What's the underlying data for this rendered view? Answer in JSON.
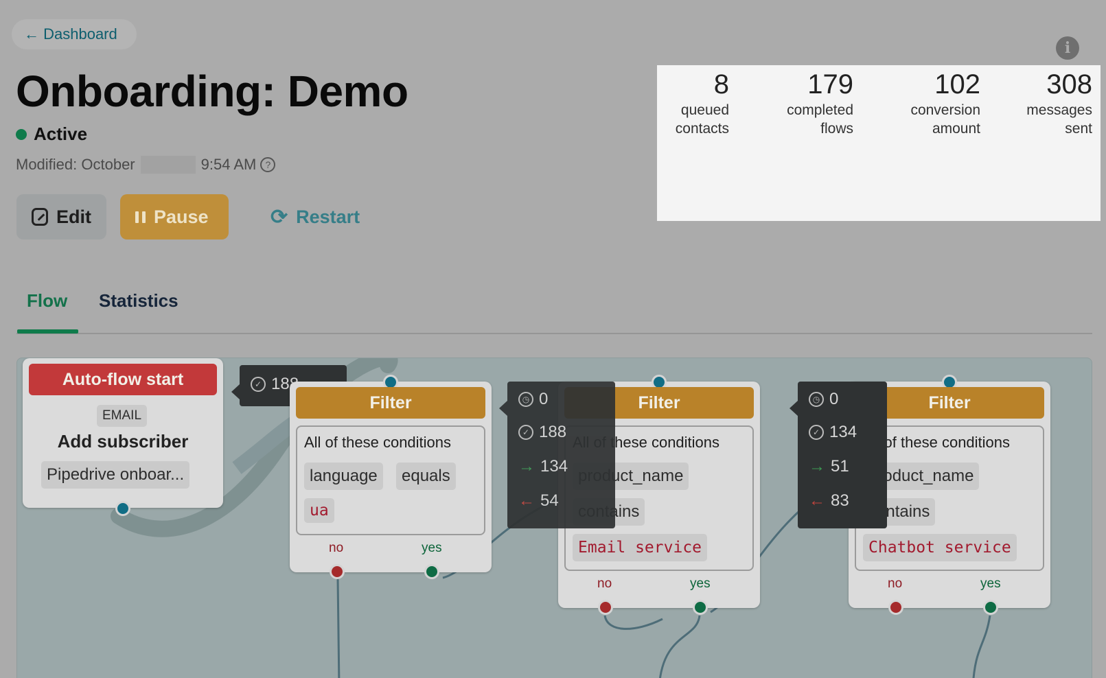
{
  "nav": {
    "back_label": "← Dashboard"
  },
  "page": {
    "title": "Onboarding: Demo",
    "status": "Active",
    "modified_prefix": "Modified: October",
    "modified_time": "9:54 AM"
  },
  "actions": {
    "edit": "Edit",
    "pause": "Pause",
    "restart": "Restart"
  },
  "stats": [
    {
      "value": "8",
      "label1": "queued",
      "label2": "contacts"
    },
    {
      "value": "179",
      "label1": "completed",
      "label2": "flows"
    },
    {
      "value": "102",
      "label1": "conversion",
      "label2": "amount"
    },
    {
      "value": "308",
      "label1": "messages",
      "label2": "sent"
    }
  ],
  "tabs": {
    "flow": "Flow",
    "statistics": "Statistics"
  },
  "flow": {
    "start": {
      "header": "Auto-flow start",
      "channel": "EMAIL",
      "action": "Add subscriber",
      "list": "Pipedrive onboar..."
    },
    "stat1": {
      "checked": "188"
    },
    "filter1": {
      "header": "Filter",
      "cond_title": "All of these conditions",
      "field": "language",
      "op": "equals",
      "value": "ua",
      "no": "no",
      "yes": "yes"
    },
    "stat2": {
      "waiting": "0",
      "checked": "188",
      "passed": "134",
      "failed": "54"
    },
    "filter2": {
      "header": "Filter",
      "cond_title": "All of these conditions",
      "field": "product_name",
      "op": "contains",
      "value": "Email service",
      "no": "no",
      "yes": "yes"
    },
    "stat3": {
      "waiting": "0",
      "checked": "134",
      "passed": "51",
      "failed": "83"
    },
    "filter3": {
      "header": "Filter",
      "cond_title": "All of these conditions",
      "field": "product_name",
      "op": "contains",
      "value": "Chatbot service",
      "no": "no",
      "yes": "yes"
    }
  },
  "colors": {
    "accent_green": "#0f7b4b",
    "pause_orange": "#bf8f3a",
    "start_red": "#c2393a",
    "filter_orange": "#b98229"
  }
}
